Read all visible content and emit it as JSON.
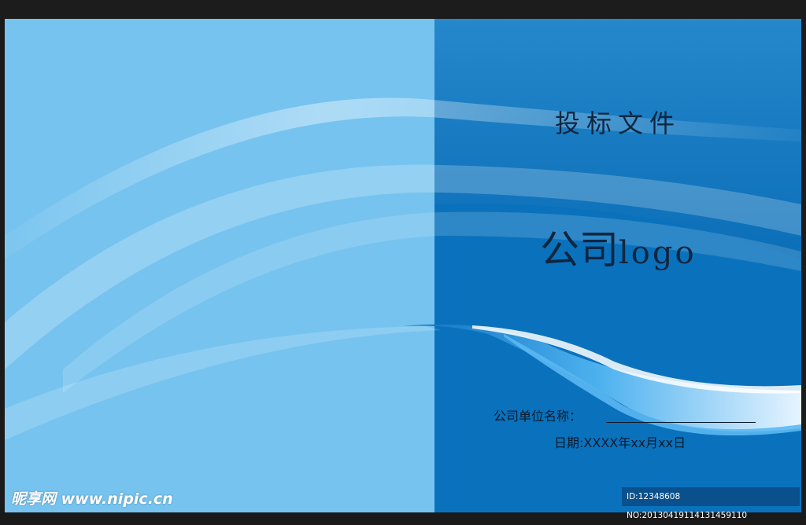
{
  "cover": {
    "title": "投标文件",
    "logo_cn": "公司",
    "logo_en": "logo",
    "company_label": "公司单位名称：",
    "date_line": "日期:XXXX年xx月xx日"
  },
  "watermarks": {
    "site": "昵享网 www.nipic.cn",
    "id_line": "ID:12348608 NO:20130419114131459110"
  },
  "colors": {
    "left_panel": "#76c3ef",
    "right_panel": "#0a72bd",
    "text": "#10263f",
    "frame": "#1c1c1c"
  }
}
